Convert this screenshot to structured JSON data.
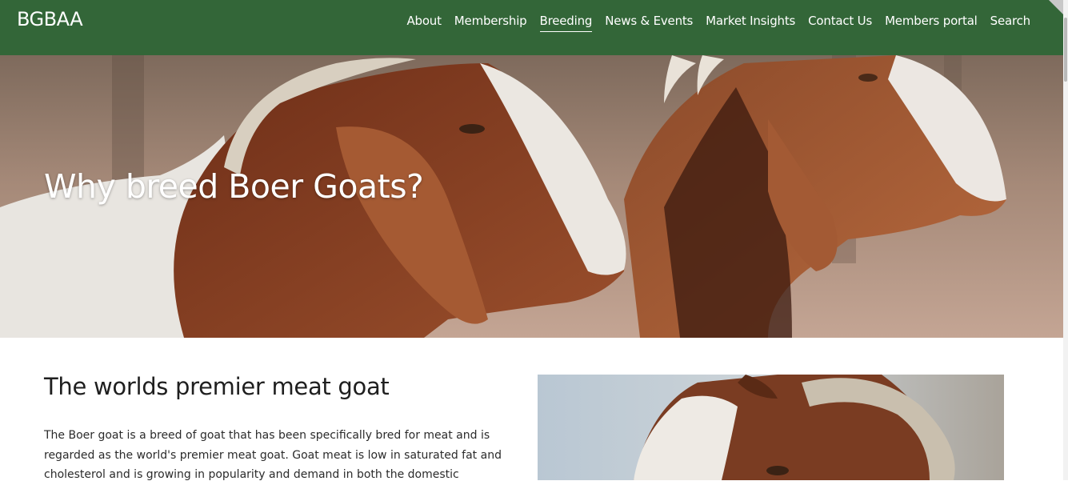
{
  "header": {
    "brand": "BGBAA",
    "nav": [
      {
        "label": "About"
      },
      {
        "label": "Membership"
      },
      {
        "label": "Breeding",
        "active": true
      },
      {
        "label": "News & Events"
      },
      {
        "label": "Market Insights"
      },
      {
        "label": "Contact Us"
      },
      {
        "label": "Members portal"
      },
      {
        "label": "Search"
      }
    ]
  },
  "hero": {
    "title": "Why breed Boer Goats?"
  },
  "main": {
    "section_title": "The worlds premier meat goat",
    "paragraph": "The Boer goat is a breed of goat that has been specifically bred for meat and is regarded as the world's premier meat goat. Goat meat is low in saturated fat and cholesterol and is growing in popularity and demand in both the domestic"
  },
  "colors": {
    "header_bg": "#336638",
    "text": "#1f1f1f",
    "white": "#ffffff"
  },
  "icons": {
    "corner": "chevron-corner-icon"
  }
}
